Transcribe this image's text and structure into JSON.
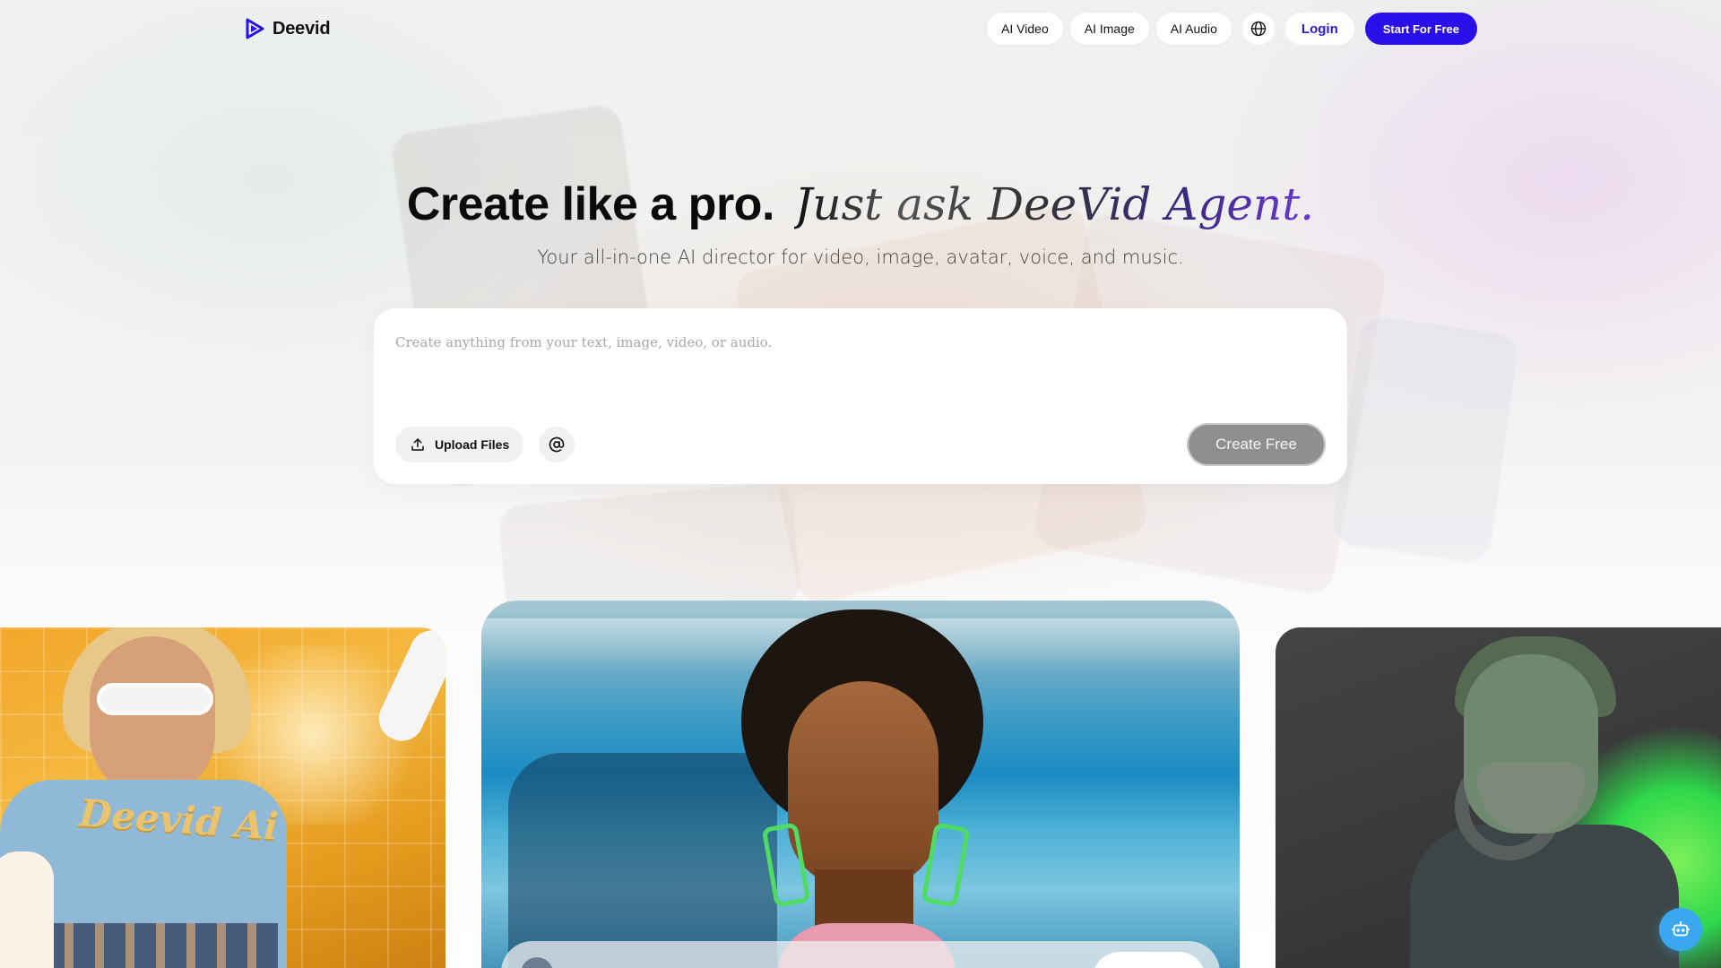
{
  "brand": {
    "name": "Deevid",
    "logo_icon": "play-triangle-icon",
    "accent": "#2a0fe8"
  },
  "nav": {
    "links": [
      {
        "label": "AI Video"
      },
      {
        "label": "AI Image"
      },
      {
        "label": "AI Audio"
      }
    ],
    "language_icon": "globe-icon",
    "login_label": "Login",
    "start_label": "Start For Free"
  },
  "hero": {
    "title_bold": "Create like a pro.",
    "title_italic": "Just ask DeeVid Agent.",
    "subtitle": "Your all-in-one AI director for video, image, avatar, voice, and music."
  },
  "prompt": {
    "placeholder": "Create anything from your text, image, video, or audio.",
    "value": "",
    "upload_label": "Upload Files",
    "upload_icon": "upload-icon",
    "mention_icon": "at-sign-icon",
    "create_label": "Create Free"
  },
  "showcase": {
    "left_card_brand_text": "Deevid Ai"
  },
  "chat_fab_icon": "robot-icon"
}
